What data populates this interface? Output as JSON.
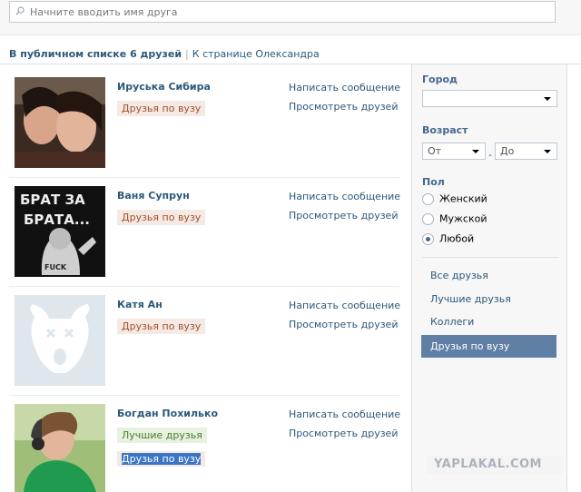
{
  "search": {
    "placeholder": "Начните вводить имя друга"
  },
  "summary": {
    "count_text": "В публичном списке 6 друзей",
    "separator": "|",
    "link": "К странице Олександра"
  },
  "filters": {
    "city_label": "Город",
    "city_value": "",
    "age_label": "Возраст",
    "age_from": "От",
    "age_dash": "-",
    "age_to": "До",
    "gender_label": "Пол",
    "gender_options": [
      {
        "label": "Женский",
        "checked": false
      },
      {
        "label": "Мужской",
        "checked": false
      },
      {
        "label": "Любой",
        "checked": true
      }
    ],
    "categories": [
      {
        "label": "Все друзья",
        "active": false
      },
      {
        "label": "Лучшие друзья",
        "active": false
      },
      {
        "label": "Коллеги",
        "active": false
      },
      {
        "label": "Друзья по вузу",
        "active": true
      }
    ]
  },
  "friends": [
    {
      "name": "Ируська Сибира",
      "tags": [
        "Друзья по вузу"
      ],
      "write": "Написать сообщение",
      "view": "Просмотреть друзей"
    },
    {
      "name": "Ваня Супрун",
      "tags": [
        "Друзья по вузу"
      ],
      "write": "Написать сообщение",
      "view": "Просмотреть друзей",
      "avatar_text": [
        "БРАТ ЗА",
        "БРАТА...",
        "FUCK"
      ]
    },
    {
      "name": "Катя Ан",
      "tags": [
        "Друзья по вузу"
      ],
      "write": "Написать сообщение",
      "view": "Просмотреть друзей"
    },
    {
      "name": "Богдан Похилько",
      "tags": [
        "Лучшие друзья",
        "Друзья по вузу"
      ],
      "write": "Написать сообщение",
      "view": "Просмотреть друзей"
    }
  ],
  "watermark": "YAPLAKAL.COM",
  "colors": {
    "link": "#2b587a",
    "accent": "#5f7fa5",
    "uni_tag_bg": "#f5e9e4",
    "best_tag_bg": "#e6f2df"
  }
}
